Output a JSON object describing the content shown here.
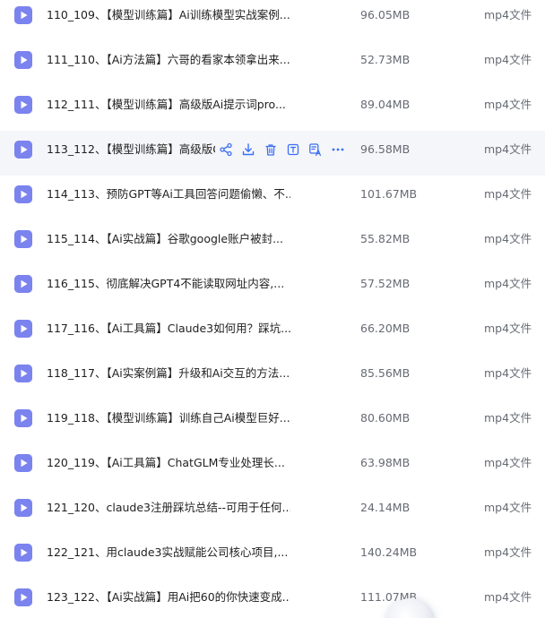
{
  "file_list": {
    "rows": [
      {
        "name": "110_109、【模型训练篇】Ai训练模型实战案例...",
        "size": "96.05MB",
        "type": "mp4文件",
        "icon": "video-file-icon"
      },
      {
        "name": "111_110、【Ai方法篇】六哥的看家本领拿出来...",
        "size": "52.73MB",
        "type": "mp4文件",
        "icon": "video-file-icon"
      },
      {
        "name": "112_111、【模型训练篇】高级版Ai提示词pro...",
        "size": "89.04MB",
        "type": "mp4文件",
        "icon": "video-file-icon"
      },
      {
        "name": "113_112、【模型训练篇】高级版G",
        "size": "96.58MB",
        "type": "mp4文件",
        "icon": "video-file-icon",
        "hovered": true
      },
      {
        "name": "114_113、预防GPT等Ai工具回答问题偷懒、不...",
        "size": "101.67MB",
        "type": "mp4文件",
        "icon": "video-file-icon"
      },
      {
        "name": "115_114、【Ai实战篇】谷歌google账户被封...",
        "size": "55.82MB",
        "type": "mp4文件",
        "icon": "video-file-icon"
      },
      {
        "name": "116_115、彻底解决GPT4不能读取网址内容,...",
        "size": "57.52MB",
        "type": "mp4文件",
        "icon": "video-file-icon"
      },
      {
        "name": "117_116、【Ai工具篇】Claude3如何用？踩坑...",
        "size": "66.20MB",
        "type": "mp4文件",
        "icon": "video-file-icon"
      },
      {
        "name": "118_117、【Ai实案例篇】升级和Ai交互的方法...",
        "size": "85.56MB",
        "type": "mp4文件",
        "icon": "video-file-icon"
      },
      {
        "name": "119_118、【模型训练篇】训练自己Ai模型巨好...",
        "size": "80.60MB",
        "type": "mp4文件",
        "icon": "video-file-icon"
      },
      {
        "name": "120_119、【Ai工具篇】ChatGLM专业处理长...",
        "size": "63.98MB",
        "type": "mp4文件",
        "icon": "video-file-icon"
      },
      {
        "name": "121_120、claude3注册踩坑总结--可用于任何...",
        "size": "24.14MB",
        "type": "mp4文件",
        "icon": "video-file-icon"
      },
      {
        "name": "122_121、用claude3实战赋能公司核心项目,...",
        "size": "140.24MB",
        "type": "mp4文件",
        "icon": "video-file-icon"
      },
      {
        "name": "123_122、【Ai实战篇】用Ai把60的你快速变成...",
        "size": "111.07MB",
        "type": "mp4文件",
        "icon": "video-file-icon"
      }
    ],
    "hover_actions": [
      {
        "icon": "share-icon"
      },
      {
        "icon": "download-icon"
      },
      {
        "icon": "delete-icon"
      },
      {
        "icon": "rename-icon"
      },
      {
        "icon": "ai-translate-icon"
      },
      {
        "icon": "more-icon"
      }
    ]
  },
  "colors": {
    "file_icon": "#7b83ee",
    "action_icon": "#3b6ff5",
    "hover_row": "#f5f6fa",
    "name_text": "#1f1f1f",
    "meta_text": "#666a73"
  }
}
